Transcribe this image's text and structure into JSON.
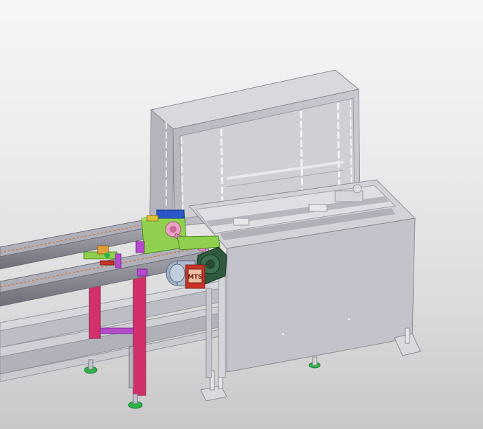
{
  "motor": {
    "label": "MTS"
  },
  "colors": {
    "background_top": "#f6f6f6",
    "background_bottom": "#c8c8c8",
    "cabinet": "#c8c8d0",
    "rail": "#8c8c96",
    "support_leg": "#d1306a",
    "gear_motor": "#2f5a3e",
    "bracket": "#8fd14f",
    "accent_blue": "#2a56c6",
    "motor_red": "#c9342a",
    "foot_green": "#2cb34a"
  },
  "icons": [
    "cad-3d-model"
  ]
}
